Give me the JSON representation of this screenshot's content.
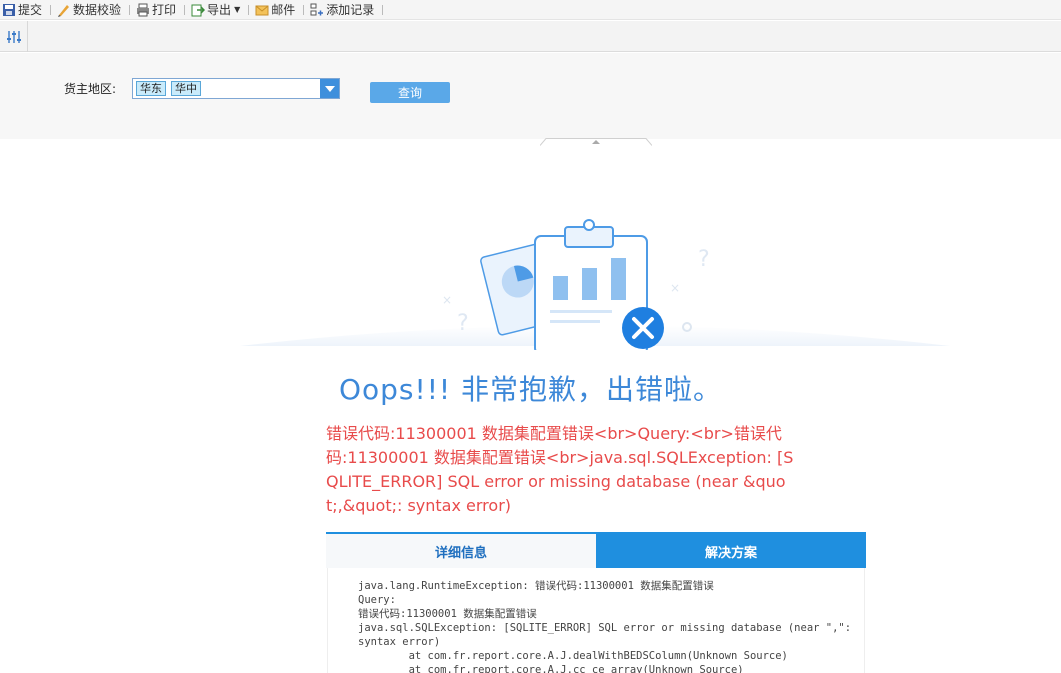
{
  "toolbar": {
    "items": [
      {
        "label": "提交",
        "icon": "submit-icon"
      },
      {
        "label": "数据校验",
        "icon": "pencil-icon"
      },
      {
        "label": "打印",
        "icon": "printer-icon"
      },
      {
        "label": "导出",
        "icon": "export-icon"
      },
      {
        "label": "邮件",
        "icon": "mail-icon"
      },
      {
        "label": "添加记录",
        "icon": "add-record-icon"
      }
    ]
  },
  "params": {
    "region_label": "货主地区:",
    "selected_tags": [
      "华东",
      "华中"
    ],
    "query_button": "查询"
  },
  "error": {
    "title": "Oops!!! 非常抱歉，出错啦。",
    "message": "错误代码:11300001 数据集配置错误<br>Query:<br>错误代码:11300001 数据集配置错误<br>java.sql.SQLException: [SQLITE_ERROR] SQL error or missing database (near &quot;,&quot;: syntax error)",
    "tabs": {
      "details": "详细信息",
      "solution": "解决方案"
    },
    "detail_lines": [
      "java.lang.RuntimeException: 错误代码:11300001 数据集配置错误",
      "Query:",
      "错误代码:11300001 数据集配置错误",
      "java.sql.SQLException: [SQLITE_ERROR] SQL error or missing database (near \",\":",
      "syntax error)",
      "        at com.fr.report.core.A.J.dealWithBEDSColumn(Unknown Source)",
      "        at com.fr.report.core.A.J.cc_ce_array(Unknown Source)"
    ]
  },
  "colors": {
    "accent": "#1f8fdf",
    "error": "#e84b4b",
    "title": "#3d88d8"
  }
}
